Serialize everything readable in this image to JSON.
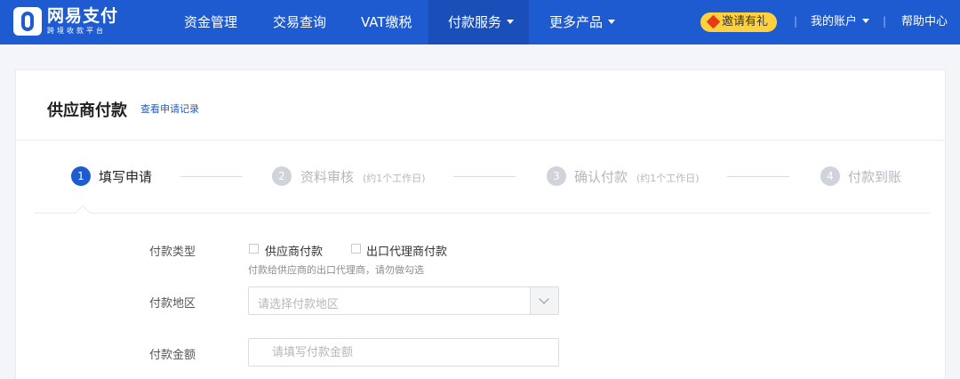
{
  "brand": {
    "title": "网易支付",
    "subtitle": "跨境收款平台",
    "brand_color": "#1e5bd0"
  },
  "nav": {
    "items": [
      {
        "label": "资金管理",
        "active": false,
        "dropdown": false
      },
      {
        "label": "交易查询",
        "active": false,
        "dropdown": false
      },
      {
        "label": "VAT缴税",
        "active": false,
        "dropdown": false
      },
      {
        "label": "付款服务",
        "active": true,
        "dropdown": true
      },
      {
        "label": "更多产品",
        "active": false,
        "dropdown": true
      }
    ],
    "invite_label": "邀请有礼",
    "account_label": "我的账户",
    "help_label": "帮助中心",
    "separator": "|"
  },
  "page": {
    "title": "供应商付款",
    "history_link": "查看申请记录"
  },
  "steps": [
    {
      "number": "1",
      "label": "填写申请",
      "note": "",
      "active": true
    },
    {
      "number": "2",
      "label": "资料审核",
      "note": "(约1个工作日)",
      "active": false
    },
    {
      "number": "3",
      "label": "确认付款",
      "note": "(约1个工作日)",
      "active": false
    },
    {
      "number": "4",
      "label": "付款到账",
      "note": "",
      "active": false
    }
  ],
  "form": {
    "payment_type": {
      "label": "付款类型",
      "options": [
        {
          "label": "供应商付款",
          "checked": false
        },
        {
          "label": "出口代理商付款",
          "checked": false
        }
      ],
      "hint": "付款给供应商的出口代理商，请勿做勾选"
    },
    "region": {
      "label": "付款地区",
      "placeholder": "请选择付款地区"
    },
    "amount": {
      "label": "付款金额",
      "placeholder": "请填写付款金额",
      "value": ""
    }
  }
}
